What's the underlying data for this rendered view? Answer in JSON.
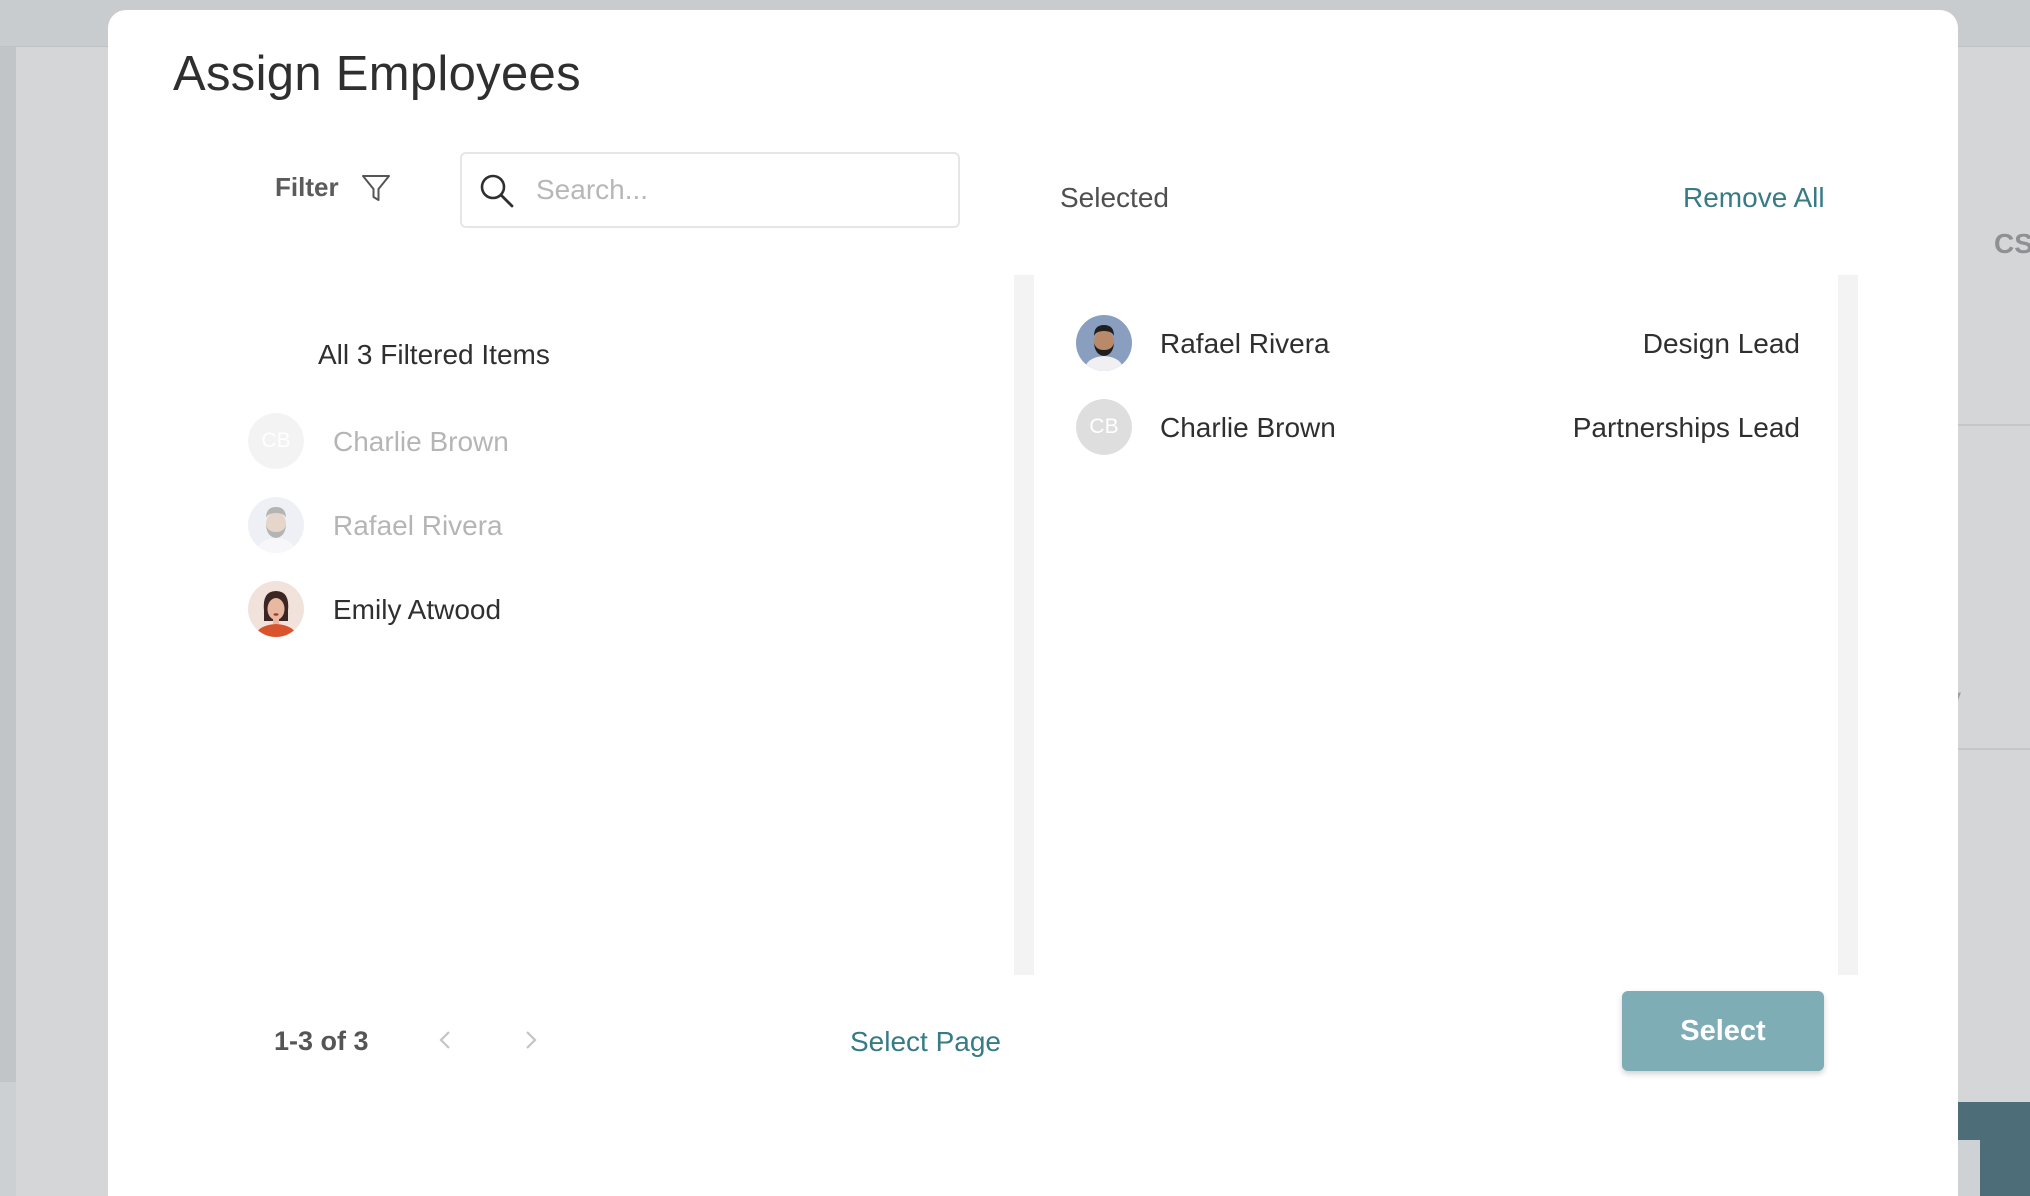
{
  "modal": {
    "title": "Assign Employees"
  },
  "toolbar": {
    "filter_label": "Filter",
    "search_placeholder": "Search...",
    "search_value": "",
    "selected_label": "Selected",
    "remove_all_label": "Remove All"
  },
  "left_list": {
    "header": "All 3 Filtered Items",
    "items": [
      {
        "name": "Charlie Brown",
        "initials": "CB",
        "avatar": "initials",
        "state": "selected"
      },
      {
        "name": "Rafael Rivera",
        "avatar": "photo-man-beard",
        "state": "selected"
      },
      {
        "name": "Emily Atwood",
        "avatar": "photo-woman-red",
        "state": "available"
      }
    ]
  },
  "selected_list": {
    "items": [
      {
        "name": "Rafael Rivera",
        "role": "Design Lead",
        "avatar": "photo-man-beard"
      },
      {
        "name": "Charlie Brown",
        "role": "Partnerships Lead",
        "initials": "CB",
        "avatar": "initials"
      }
    ]
  },
  "footer": {
    "pager_label": "1-3 of 3",
    "select_page_label": "Select Page",
    "select_button_label": "Select"
  },
  "background": {
    "right_text": "CS",
    "right_text2": "y"
  },
  "colors": {
    "accent": "#367b85",
    "select_button": "#7fadb6"
  }
}
